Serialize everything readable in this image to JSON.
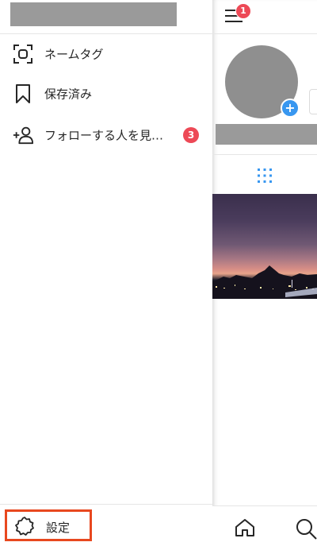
{
  "drawer": {
    "menu": [
      {
        "label": "ネームタグ",
        "icon": "nametag-icon"
      },
      {
        "label": "保存済み",
        "icon": "bookmark-icon"
      },
      {
        "label": "フォローする人を見…",
        "icon": "add-person-icon",
        "badge": "3"
      }
    ],
    "settings": {
      "label": "設定",
      "icon": "gear-icon"
    }
  },
  "profile": {
    "menu_badge": "1",
    "add_story_symbol": "+"
  },
  "colors": {
    "badge": "#ed4956",
    "accent_blue": "#3897f0",
    "highlight_border": "#e8481f"
  }
}
